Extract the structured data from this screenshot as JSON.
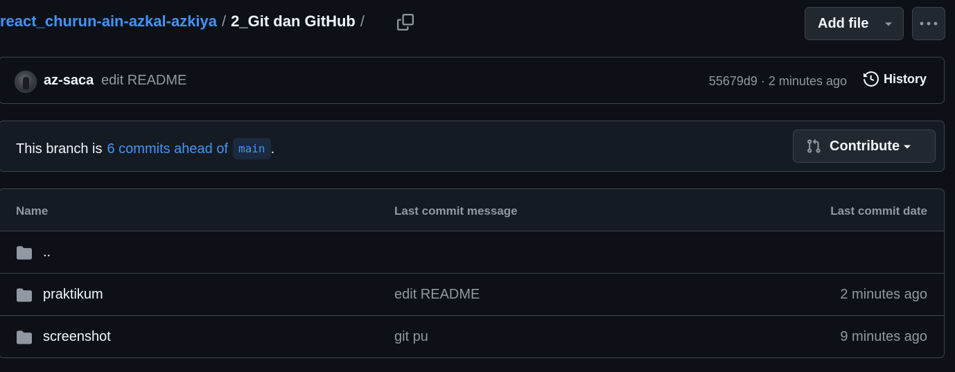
{
  "breadcrumb": {
    "repo_link": "react_churun-ain-azkal-azkiya",
    "separator": "/",
    "current_folder": "2_Git dan GitHub",
    "trailing_separator": "/"
  },
  "toolbar": {
    "add_file_label": "Add file",
    "more_label": "···"
  },
  "latest_commit": {
    "author": "az-saca",
    "message": "edit README",
    "hash_and_time": "55679d9 · 2 minutes ago",
    "history_label": "History"
  },
  "branch_status": {
    "prefix": "This branch is",
    "ahead_text": "6 commits ahead of",
    "base_branch": "main",
    "suffix": ".",
    "contribute_label": "Contribute"
  },
  "file_table": {
    "columns": {
      "name": "Name",
      "message": "Last commit message",
      "date": "Last commit date"
    },
    "rows": [
      {
        "name": "..",
        "message": "",
        "date": ""
      },
      {
        "name": "praktikum",
        "message": "edit README",
        "date": "2 minutes ago"
      },
      {
        "name": "screenshot",
        "message": "git pu",
        "date": "9 minutes ago"
      }
    ]
  },
  "colors": {
    "background": "#0d1117",
    "link": "#4493f8",
    "muted_text": "#9198a1",
    "border": "#3d444d",
    "icon": "#9198a1"
  },
  "icons": {
    "copy": "copy-icon",
    "caret": "triangle-down-icon",
    "more": "kebab-horizontal-icon",
    "history": "history-icon",
    "contribute": "git-pull-request-icon",
    "folder": "file-directory-icon"
  }
}
